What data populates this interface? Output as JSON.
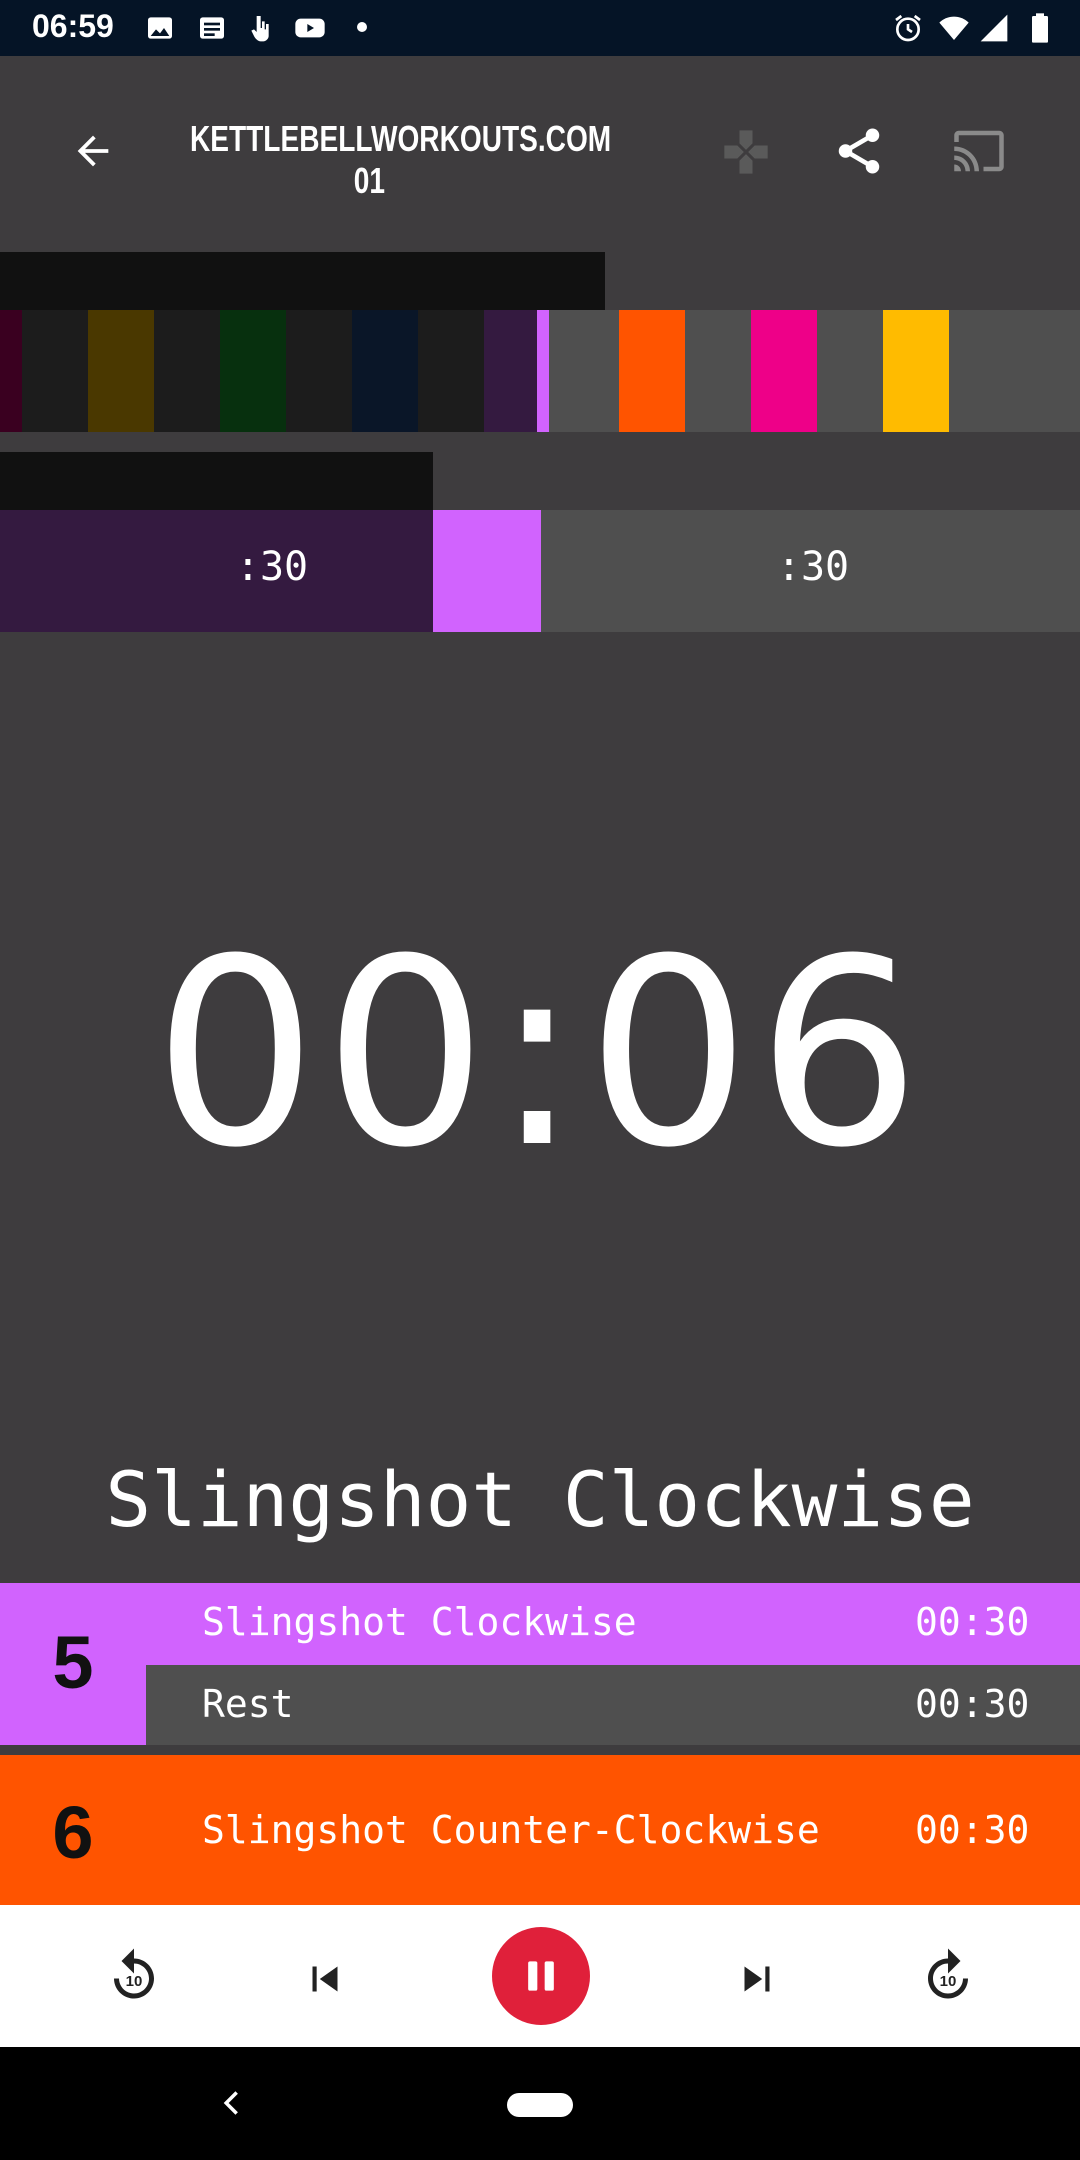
{
  "status_bar": {
    "time": "06:59",
    "left_icons": [
      "image-icon",
      "news-icon",
      "touch-icon",
      "youtube-icon",
      "dot-icon"
    ],
    "right_icons": [
      "alarm-icon",
      "wifi-icon",
      "signal-icon",
      "battery-icon"
    ]
  },
  "app_bar": {
    "title": "KETTLEBELLWORKOUTS.COM 01",
    "icons": [
      "back-arrow-icon",
      "gamepad-icon",
      "share-icon",
      "cast-icon"
    ]
  },
  "timeline": {
    "segment_colors": [
      "#3a0020",
      "#1c1c1c",
      "#4a3800",
      "#1c1c1c",
      "#07300e",
      "#1c1c1c",
      "#0a1628",
      "#1c1c1c",
      "#341a40",
      "#d163fe",
      "#4f4f4f",
      "#ff5400",
      "#4f4f4f",
      "#ee0088",
      "#4f4f4f",
      "#ffbb00",
      "#4f4f4f"
    ],
    "left_label": ":30",
    "right_label": ":30",
    "marker_color": "#d163fe"
  },
  "timer": {
    "display": "00:06",
    "exercise": "Slingshot Clockwise"
  },
  "list": {
    "rows": [
      {
        "number": "5",
        "color": "#d163fe",
        "items": [
          {
            "name": "Slingshot Clockwise",
            "time": "00:30"
          },
          {
            "name": "Rest",
            "time": "00:30"
          }
        ]
      },
      {
        "number": "6",
        "color": "#ff5400",
        "items": [
          {
            "name": "Slingshot Counter-Clockwise",
            "time": "00:30"
          }
        ]
      }
    ]
  },
  "controls": {
    "icons": [
      "replay-10-icon",
      "skip-previous-icon",
      "pause-icon",
      "skip-next-icon",
      "forward-10-icon"
    ],
    "replay_text": "10",
    "forward_text": "10",
    "pause_color": "#e0203a"
  },
  "nav_bar": {
    "icons": [
      "nav-back-icon",
      "nav-home-pill"
    ]
  }
}
